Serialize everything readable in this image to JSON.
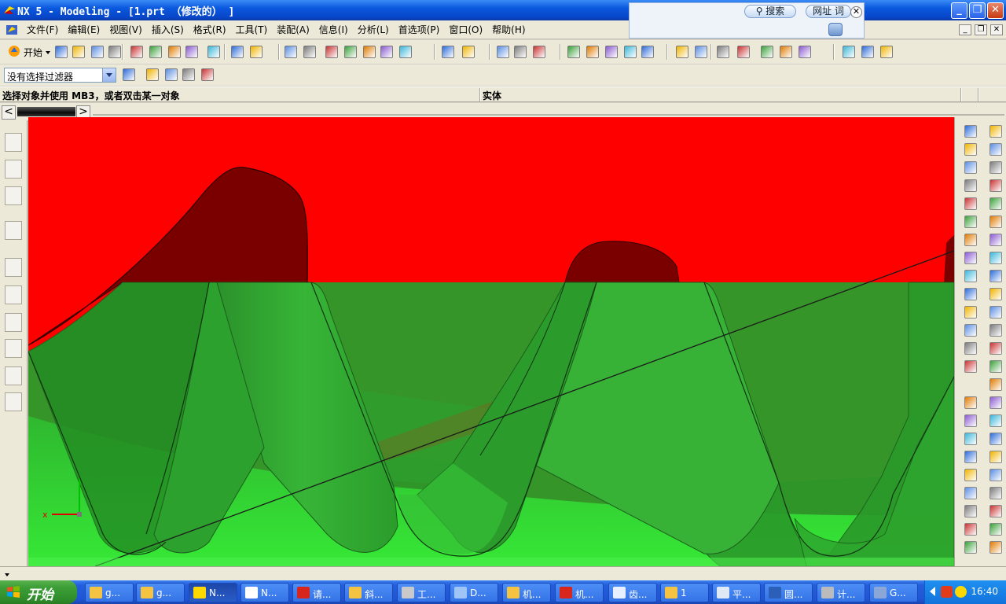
{
  "window": {
    "title": "NX 5 - Modeling - [1.prt （修改的） ]"
  },
  "search_widget": {
    "search_label": "搜索",
    "url_label": "网址",
    "word_label": "词",
    "close_glyph": "✕"
  },
  "menu": {
    "items": [
      "文件(F)",
      "编辑(E)",
      "视图(V)",
      "插入(S)",
      "格式(R)",
      "工具(T)",
      "装配(A)",
      "信息(I)",
      "分析(L)",
      "首选项(P)",
      "窗口(O)",
      "帮助(H)"
    ]
  },
  "toolbar": {
    "start_label": "开始"
  },
  "selection": {
    "filter_value": "没有选择过滤器"
  },
  "cue": {
    "prompt": "选择对象并使用 MB3，或者双击某一对象",
    "status": "实体"
  },
  "tabs": {
    "prev": "<",
    "next": ">"
  },
  "triad": {
    "x_label": "x"
  },
  "taskbar": {
    "start_label": "开始",
    "buttons": [
      {
        "label": "g...",
        "icon": "folder-icon"
      },
      {
        "label": "g...",
        "icon": "folder-icon"
      },
      {
        "label": "N...",
        "icon": "nx-icon"
      },
      {
        "label": "N...",
        "icon": "notepad-icon"
      },
      {
        "label": "请...",
        "icon": "pdf-icon"
      },
      {
        "label": "斜...",
        "icon": "folder-icon"
      },
      {
        "label": "工...",
        "icon": "tool-icon"
      },
      {
        "label": "D...",
        "icon": "browser-icon"
      },
      {
        "label": "机...",
        "icon": "folder-icon"
      },
      {
        "label": "机...",
        "icon": "pdf-icon"
      },
      {
        "label": "齿...",
        "icon": "doc-icon"
      },
      {
        "label": "1",
        "icon": "folder-icon"
      },
      {
        "label": "平...",
        "icon": "window-icon"
      },
      {
        "label": "圆...",
        "icon": "word-icon"
      },
      {
        "label": "计...",
        "icon": "calc-icon"
      },
      {
        "label": "G...",
        "icon": "app-icon"
      }
    ],
    "time": "16:40"
  },
  "colors": {
    "background": "#ff0000",
    "gear_dark": "#7a0000",
    "tooth_green": "#2fb02f"
  }
}
